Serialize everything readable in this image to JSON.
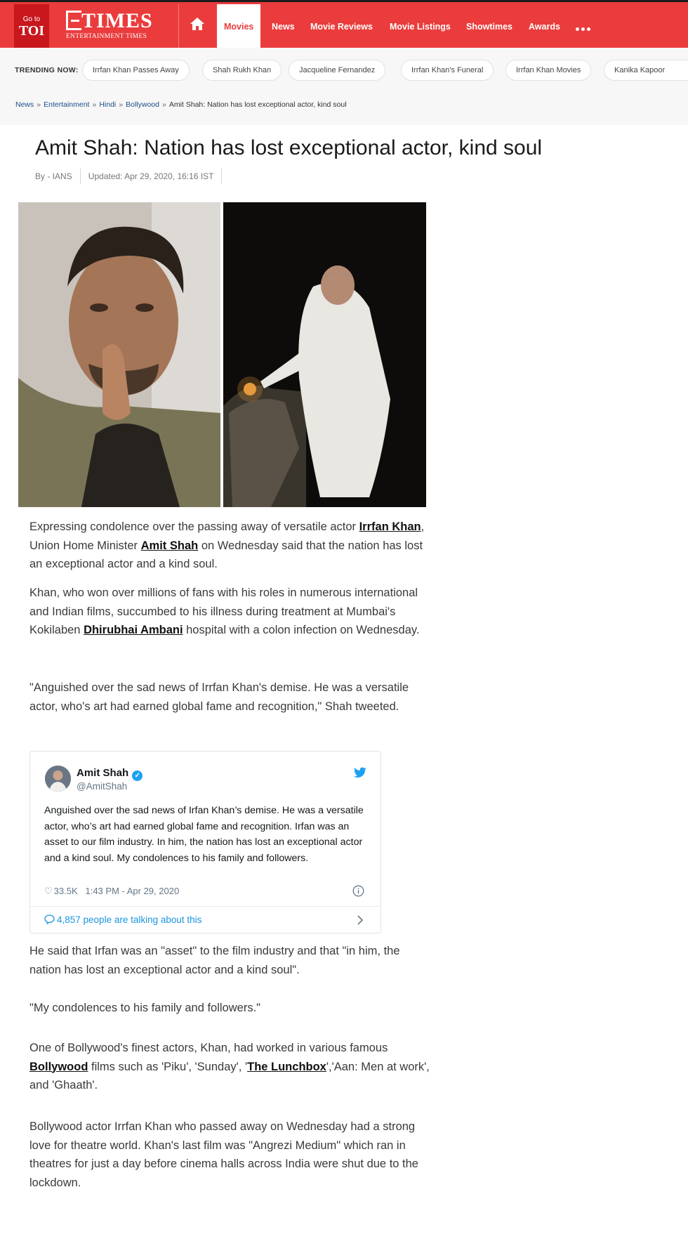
{
  "topnav": {
    "goto_line1": "Go to",
    "goto_line2": "TOI",
    "logo_main": "TIMES",
    "logo_sub": "ENTERTAINMENT TIMES",
    "items": [
      {
        "label": "Movies",
        "active": true
      },
      {
        "label": "News"
      },
      {
        "label": "Movie Reviews"
      },
      {
        "label": "Movie Listings"
      },
      {
        "label": "Showtimes"
      },
      {
        "label": "Awards"
      }
    ],
    "brand_color": "#ea3c3c"
  },
  "trending": {
    "label": "TRENDING NOW:",
    "chips": [
      "Irrfan Khan Passes Away",
      "Shah Rukh Khan",
      "Jacqueline Fernandez",
      "Irrfan Khan's Funeral",
      "Irrfan Khan Movies",
      "Kanika Kapoor"
    ]
  },
  "breadcrumb": {
    "items": [
      "News",
      "Entertainment",
      "Hindi",
      "Bollywood"
    ],
    "current": "Amit Shah: Nation has lost exceptional actor, kind soul"
  },
  "article": {
    "title": "Amit Shah: Nation has lost exceptional actor, kind soul",
    "byline": "By - IANS",
    "updated": "Updated: Apr 29, 2020, 16:16 IST",
    "p1": {
      "t1": "Expressing condolence over the passing away of versatile actor ",
      "link1": "Irrfan Khan",
      "t2": ", Union Home Minister ",
      "link2": "Amit Shah",
      "t3": " on Wednesday said that the nation has lost an exceptional actor and a kind soul."
    },
    "p2": {
      "t1": "Khan, who won over millions of fans with his roles in numerous international and Indian films, succumbed to his illness during treatment at Mumbai's Kokilaben ",
      "link1": "Dhirubhai Ambani",
      "t2": " hospital with a colon infection on Wednesday."
    },
    "p3": "\"Anguished over the sad news of Irrfan Khan's demise. He was a versatile actor, who's art had earned global fame and recognition,\" Shah tweeted.",
    "p4": "He said that Irfan was an \"asset\" to the film industry and that \"in him, the nation has lost an exceptional actor and a kind soul\".",
    "p5": "\"My condolences to his family and followers.\"",
    "p6": {
      "t1": "One of Bollywood's finest actors, Khan, had worked in various famous ",
      "link1": "Bollywood",
      "t2": " films such as 'Piku', 'Sunday', '",
      "link2": "The Lunchbox",
      "t3": "','Aan: Men at work', and 'Ghaath'."
    },
    "p7": "Bollywood actor Irrfan Khan who passed away on Wednesday had a strong love for theatre world. Khan's last film was \"Angrezi Medium\" which ran in theatres for just a day before cinema halls across India were shut due to the lockdown."
  },
  "tweet": {
    "name": "Amit Shah",
    "handle": "@AmitShah",
    "text": "Anguished over the sad news of Irfan Khan’s demise. He was a versatile actor, who’s art had earned global fame and recognition. Irfan was an asset to our film industry. In him, the nation has lost an exceptional actor and a kind soul. My condolences to his family and followers.",
    "likes": "33.5K",
    "time": "1:43 PM - Apr 29, 2020",
    "talking": "4,857 people are talking about this",
    "accent": "#1da1f2"
  }
}
